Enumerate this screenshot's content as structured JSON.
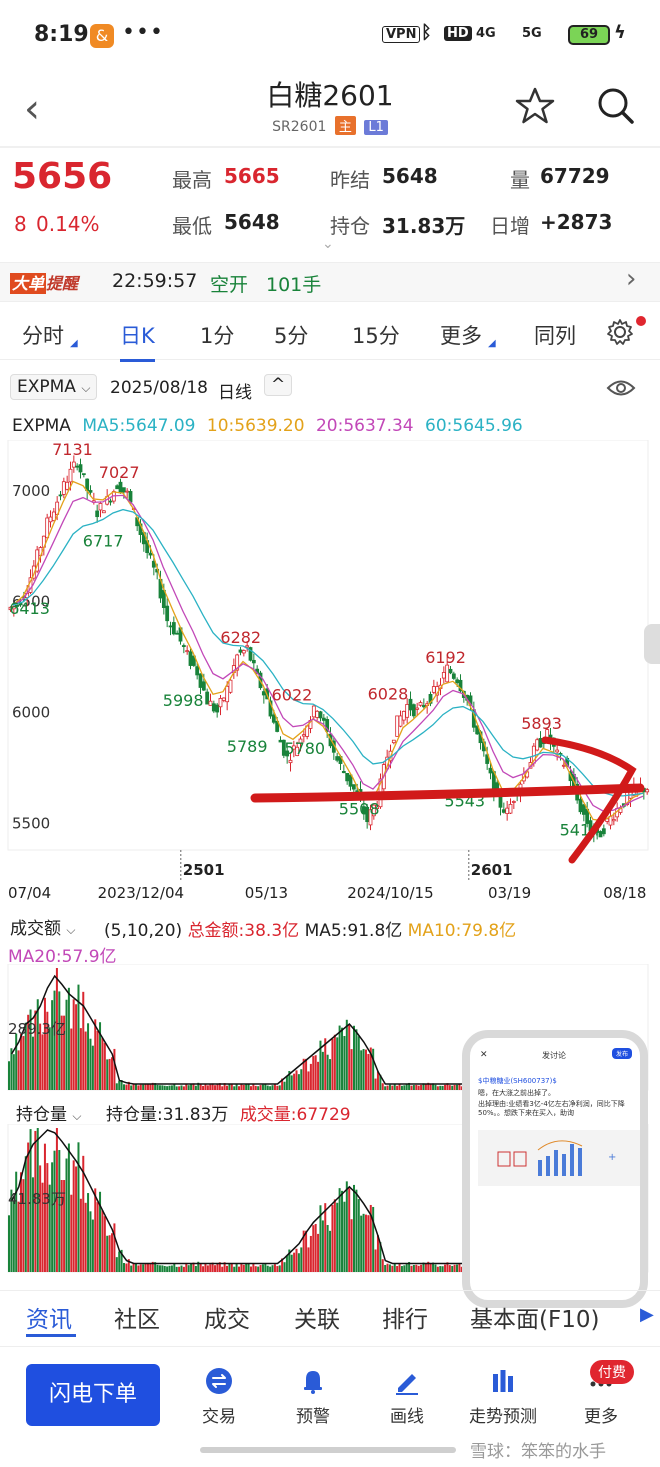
{
  "status": {
    "time": "8:19",
    "app_badge": "&",
    "dots": "•••",
    "vpn": "VPN",
    "hd": "HD",
    "net1": "4G",
    "net2": "5G",
    "battery": "69"
  },
  "header": {
    "title": "白糖2601",
    "code": "SR2601",
    "tag_main": "主",
    "tag_l1": "L1"
  },
  "quote": {
    "last": "5656",
    "change": "8",
    "change_pct": "0.14%",
    "high_label": "最高",
    "high": "5665",
    "low_label": "最低",
    "low": "5648",
    "prev_label": "昨结",
    "prev": "5648",
    "oi_label": "持仓",
    "oi": "31.83万",
    "vol_label": "量",
    "vol": "67729",
    "daychg_label": "日增",
    "daychg": "+2873"
  },
  "alert": {
    "brand1": "大单",
    "brand2": "提醒",
    "time": "22:59:57",
    "action": "空开",
    "lots": "101手"
  },
  "tabs": [
    {
      "label": "分时"
    },
    {
      "label": "日K"
    },
    {
      "label": "1分"
    },
    {
      "label": "5分"
    },
    {
      "label": "15分"
    },
    {
      "label": "更多"
    },
    {
      "label": "同列"
    }
  ],
  "indicator": {
    "name": "EXPMA",
    "date": "2025/08/18",
    "period": "日线"
  },
  "ma": {
    "name": "EXPMA",
    "ma5": "MA5:5647.09",
    "ma10": "10:5639.20",
    "ma20": "20:5637.34",
    "ma60": "60:5645.96",
    "c5": "#2bb2c4",
    "c10": "#e3a21a",
    "c20": "#c248b8",
    "c60": "#2bb2c4"
  },
  "chart_data": {
    "type": "candlestick",
    "y_ticks": [
      "7000",
      "6500",
      "6000",
      "5500"
    ],
    "ylim": [
      5420,
      7180
    ],
    "x_ticks": [
      "07/04",
      "2023/12/04",
      "05/13",
      "2024/10/15",
      "03/19",
      "08/18"
    ],
    "contract_markers": [
      "2501",
      "2601"
    ],
    "annotations": [
      {
        "label": "7131",
        "x": 0.097,
        "y": 7131,
        "color": "red"
      },
      {
        "label": "7027",
        "x": 0.17,
        "y": 7027,
        "color": "red"
      },
      {
        "label": "6717",
        "x": 0.145,
        "y": 6717,
        "color": "green"
      },
      {
        "label": "6413",
        "x": 0.03,
        "y": 6413,
        "color": "green"
      },
      {
        "label": "6282",
        "x": 0.36,
        "y": 6282,
        "color": "red"
      },
      {
        "label": "5998",
        "x": 0.27,
        "y": 5998,
        "color": "green"
      },
      {
        "label": "6022",
        "x": 0.44,
        "y": 6022,
        "color": "red"
      },
      {
        "label": "5789",
        "x": 0.37,
        "y": 5789,
        "color": "green"
      },
      {
        "label": "5780",
        "x": 0.46,
        "y": 5780,
        "color": "green"
      },
      {
        "label": "6028",
        "x": 0.59,
        "y": 6028,
        "color": "red"
      },
      {
        "label": "5508",
        "x": 0.545,
        "y": 5508,
        "color": "green"
      },
      {
        "label": "6192",
        "x": 0.68,
        "y": 6192,
        "color": "red"
      },
      {
        "label": "5543",
        "x": 0.71,
        "y": 5543,
        "color": "green"
      },
      {
        "label": "5893",
        "x": 0.83,
        "y": 5893,
        "color": "red"
      },
      {
        "label": "5414",
        "x": 0.89,
        "y": 5414,
        "color": "green"
      }
    ],
    "close": [
      6480,
      6560,
      6700,
      6850,
      6950,
      7050,
      7131,
      7000,
      6900,
      6950,
      7027,
      6980,
      6850,
      6717,
      6600,
      6413,
      6350,
      6250,
      6180,
      6050,
      5998,
      6100,
      6250,
      6282,
      6150,
      6050,
      5900,
      5789,
      5850,
      5950,
      6022,
      5900,
      5780,
      5700,
      5620,
      5508,
      5600,
      5800,
      5950,
      6028,
      6000,
      6050,
      6100,
      6192,
      6150,
      6050,
      5900,
      5750,
      5600,
      5543,
      5650,
      5750,
      5850,
      5893,
      5800,
      5750,
      5600,
      5500,
      5430,
      5500,
      5560,
      5610,
      5650,
      5656
    ]
  },
  "turnover": {
    "title": "成交额",
    "params": "(5,10,20)",
    "total": "总金额:38.3亿",
    "ma5": "MA5:91.8亿",
    "ma10": "MA10:79.8亿",
    "ma20": "MA20:57.9亿",
    "tick": "289.3亿",
    "bars": [
      30,
      40,
      55,
      60,
      70,
      85,
      95,
      88,
      80,
      75,
      70,
      60,
      50,
      40,
      30,
      8,
      6,
      5,
      5,
      5,
      5,
      5,
      5,
      5,
      5,
      5,
      5,
      5,
      5,
      5,
      5,
      5,
      5,
      5,
      5,
      5,
      5,
      5,
      10,
      15,
      20,
      25,
      30,
      35,
      40,
      45,
      50,
      55,
      48,
      40,
      30,
      15,
      5,
      5,
      5,
      5,
      5,
      5,
      5,
      5,
      5,
      5,
      5,
      5
    ]
  },
  "oi_panel": {
    "title": "持仓量",
    "oi": "持仓量:31.83万",
    "vol": "成交量:67729",
    "tick": "41.83万",
    "bars": [
      50,
      60,
      80,
      90,
      95,
      100,
      98,
      92,
      85,
      78,
      70,
      60,
      50,
      40,
      30,
      15,
      8,
      6,
      6,
      6,
      6,
      6,
      6,
      6,
      6,
      6,
      6,
      6,
      6,
      6,
      6,
      6,
      6,
      6,
      6,
      6,
      6,
      6,
      10,
      15,
      20,
      28,
      35,
      40,
      45,
      50,
      55,
      60,
      55,
      48,
      40,
      25,
      8,
      6,
      6,
      6,
      6,
      6,
      6,
      6,
      6,
      6,
      6,
      6
    ]
  },
  "bottom_tabs": [
    {
      "label": "资讯"
    },
    {
      "label": "社区"
    },
    {
      "label": "成交"
    },
    {
      "label": "关联"
    },
    {
      "label": "排行"
    },
    {
      "label": "基本面(F10)"
    }
  ],
  "toolbar": {
    "trade": "闪电下单",
    "t1": "交易",
    "t2": "预警",
    "t3": "画线",
    "t4": "走势预测",
    "t5": "更多",
    "paid": "付费"
  },
  "popup": {
    "title": "发讨论",
    "post": "发布",
    "stock": "$中粮糖业(SH600737)$",
    "line1": "嗯，在大涨之前出掉了。",
    "line2": "出掉理由:业绩看3亿-4亿左右净利润，同比下降50%。。想跌下来在买入，助询"
  },
  "watermark": "雪球：笨笨的水手"
}
